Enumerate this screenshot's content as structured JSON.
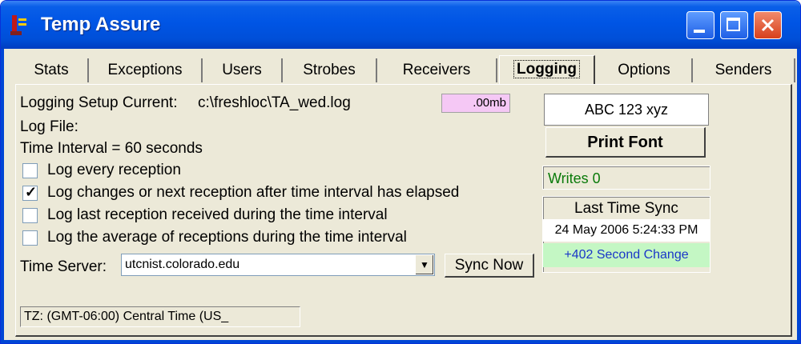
{
  "window": {
    "title": "Temp Assure"
  },
  "tabs": [
    {
      "label": "Stats"
    },
    {
      "label": "Exceptions"
    },
    {
      "label": "Users"
    },
    {
      "label": "Strobes"
    },
    {
      "label": "Receivers"
    },
    {
      "label": "Logging"
    },
    {
      "label": "Options"
    },
    {
      "label": "Senders"
    }
  ],
  "active_tab": "Logging",
  "logging": {
    "setup_label": "Logging Setup Current:",
    "setup_path": "c:\\freshloc\\TA_wed.log",
    "file_size": ".00mb",
    "log_file_label": "Log File:",
    "interval_text": "Time Interval = 60 seconds",
    "options": [
      {
        "label": "Log every reception",
        "checked": false
      },
      {
        "label": "Log changes or next reception after time interval has elapsed",
        "checked": true
      },
      {
        "label": "Log last reception received during the time interval",
        "checked": false
      },
      {
        "label": "Log the average of receptions during the time interval",
        "checked": false
      }
    ],
    "time_server_label": "Time Server:",
    "time_server_value": "utcnist.colorado.edu",
    "sync_button": "Sync Now",
    "timezone": "TZ: (GMT-06:00) Central Time (US_"
  },
  "side": {
    "font_sample": "ABC 123 xyz",
    "print_font_button": "Print Font",
    "writes": "Writes  0",
    "last_sync_title": "Last Time Sync",
    "last_sync_date": "24 May 2006 5:24:33 PM",
    "last_sync_change": "+402 Second Change"
  },
  "colors": {
    "titlebar": "#0055e5",
    "size_box": "#f5c8f5",
    "change_bg": "#c4f7c4",
    "writes_text": "#0a7a0a"
  }
}
